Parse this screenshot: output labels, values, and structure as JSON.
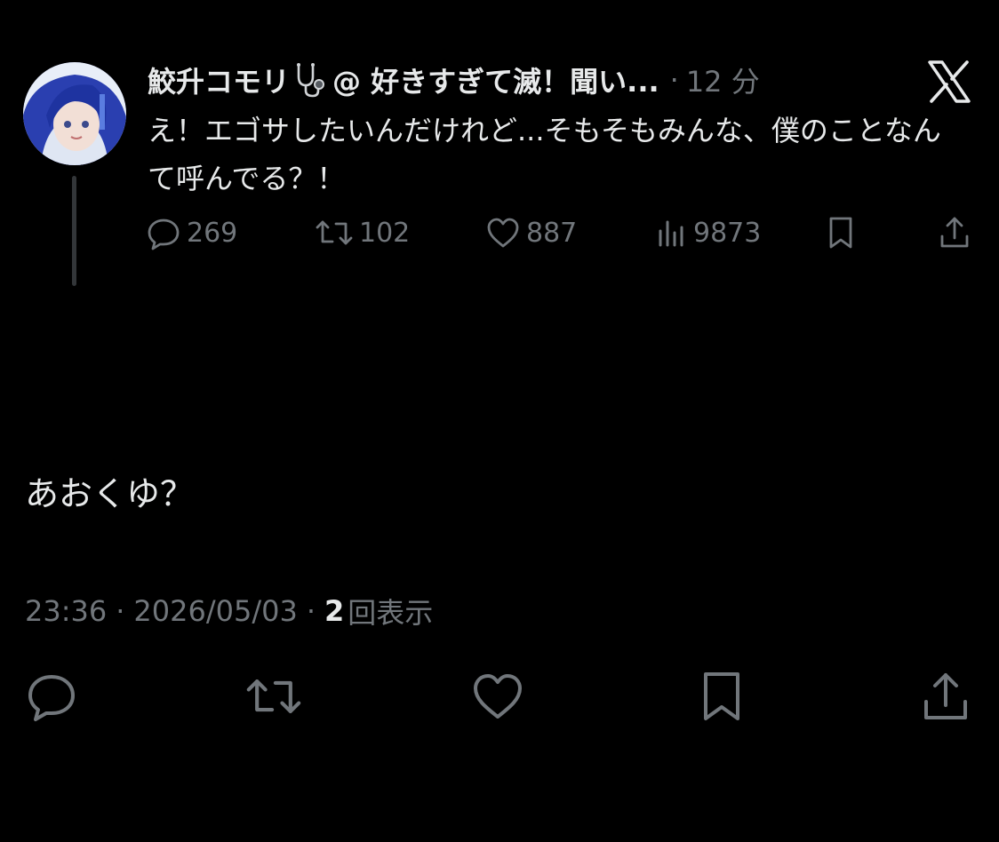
{
  "colors": {
    "background": "#000000",
    "primary_text": "#e7e9ea",
    "secondary_text": "#71767b",
    "thread_line": "#333639",
    "avatar_blue": "#2f3a8a"
  },
  "parent_tweet": {
    "display_name": "鮫升コモリ",
    "name_emoji": "stethoscope-icon",
    "handle_truncated": "@ 好きすぎて滅！聞い...",
    "separator": "·",
    "time_ago": "12 分",
    "text": "え！エゴサしたいんだけれど...そもそもみんな、僕のことなんて呼んでる？！",
    "actions": {
      "reply_count": "269",
      "retweet_count": "102",
      "like_count": "887",
      "views_count": "9873"
    }
  },
  "brand_icon": "x-logo-icon",
  "reply_tweet": {
    "text": "あおくゆ？",
    "time": "23:36",
    "separator": "·",
    "date": "2026/05/03",
    "views_count": "2",
    "views_label": "回表示"
  },
  "icons": {
    "reply": "reply-icon",
    "retweet": "retweet-icon",
    "like": "heart-icon",
    "views": "views-icon",
    "bookmark": "bookmark-icon",
    "share": "share-icon"
  }
}
